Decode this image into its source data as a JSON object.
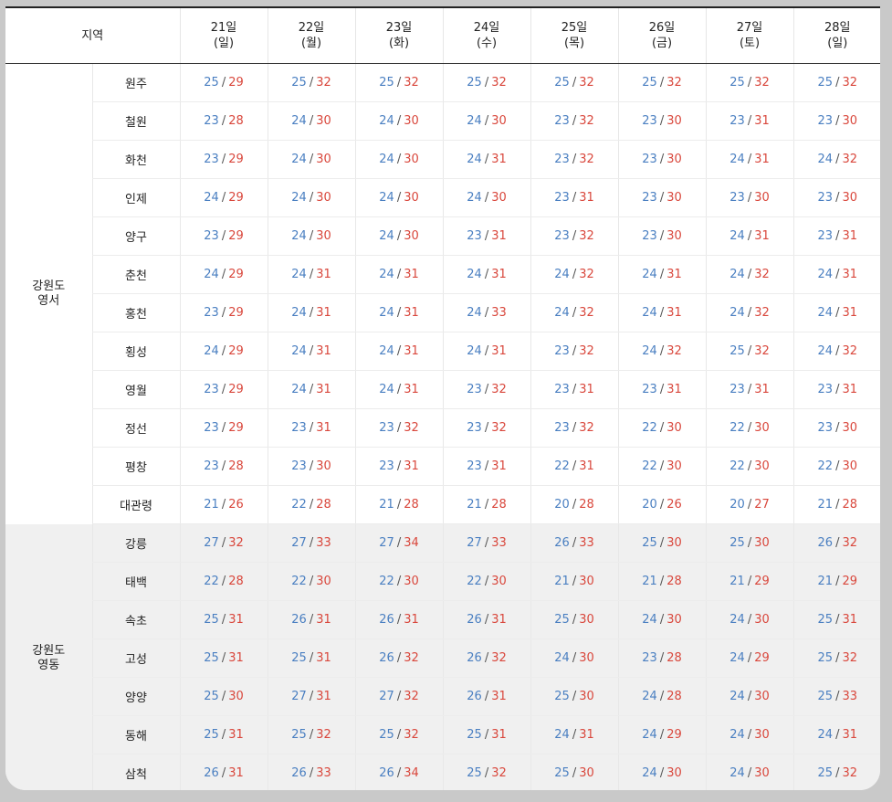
{
  "header": {
    "region_label": "지역",
    "days": [
      {
        "date": "21일",
        "weekday": "(일)"
      },
      {
        "date": "22일",
        "weekday": "(월)"
      },
      {
        "date": "23일",
        "weekday": "(화)"
      },
      {
        "date": "24일",
        "weekday": "(수)"
      },
      {
        "date": "25일",
        "weekday": "(목)"
      },
      {
        "date": "26일",
        "weekday": "(금)"
      },
      {
        "date": "27일",
        "weekday": "(토)"
      },
      {
        "date": "28일",
        "weekday": "(일)"
      }
    ]
  },
  "separator": "/",
  "colors": {
    "low_temp": "#4a7fc1",
    "high_temp": "#d9473c",
    "east_row_bg": "#f0f0f0"
  },
  "groups": [
    {
      "name_line1": "강원도",
      "name_line2": "영서",
      "shaded": false,
      "rows": [
        {
          "city": "원주",
          "temps": [
            [
              25,
              29
            ],
            [
              25,
              32
            ],
            [
              25,
              32
            ],
            [
              25,
              32
            ],
            [
              25,
              32
            ],
            [
              25,
              32
            ],
            [
              25,
              32
            ],
            [
              25,
              32
            ]
          ]
        },
        {
          "city": "철원",
          "temps": [
            [
              23,
              28
            ],
            [
              24,
              30
            ],
            [
              24,
              30
            ],
            [
              24,
              30
            ],
            [
              23,
              32
            ],
            [
              23,
              30
            ],
            [
              23,
              31
            ],
            [
              23,
              30
            ]
          ]
        },
        {
          "city": "화천",
          "temps": [
            [
              23,
              29
            ],
            [
              24,
              30
            ],
            [
              24,
              30
            ],
            [
              24,
              31
            ],
            [
              23,
              32
            ],
            [
              23,
              30
            ],
            [
              24,
              31
            ],
            [
              24,
              32
            ]
          ]
        },
        {
          "city": "인제",
          "temps": [
            [
              24,
              29
            ],
            [
              24,
              30
            ],
            [
              24,
              30
            ],
            [
              24,
              30
            ],
            [
              23,
              31
            ],
            [
              23,
              30
            ],
            [
              23,
              30
            ],
            [
              23,
              30
            ]
          ]
        },
        {
          "city": "양구",
          "temps": [
            [
              23,
              29
            ],
            [
              24,
              30
            ],
            [
              24,
              30
            ],
            [
              23,
              31
            ],
            [
              23,
              32
            ],
            [
              23,
              30
            ],
            [
              24,
              31
            ],
            [
              23,
              31
            ]
          ]
        },
        {
          "city": "춘천",
          "temps": [
            [
              24,
              29
            ],
            [
              24,
              31
            ],
            [
              24,
              31
            ],
            [
              24,
              31
            ],
            [
              24,
              32
            ],
            [
              24,
              31
            ],
            [
              24,
              32
            ],
            [
              24,
              31
            ]
          ]
        },
        {
          "city": "홍천",
          "temps": [
            [
              23,
              29
            ],
            [
              24,
              31
            ],
            [
              24,
              31
            ],
            [
              24,
              33
            ],
            [
              24,
              32
            ],
            [
              24,
              31
            ],
            [
              24,
              32
            ],
            [
              24,
              31
            ]
          ]
        },
        {
          "city": "횡성",
          "temps": [
            [
              24,
              29
            ],
            [
              24,
              31
            ],
            [
              24,
              31
            ],
            [
              24,
              31
            ],
            [
              23,
              32
            ],
            [
              24,
              32
            ],
            [
              25,
              32
            ],
            [
              24,
              32
            ]
          ]
        },
        {
          "city": "영월",
          "temps": [
            [
              23,
              29
            ],
            [
              24,
              31
            ],
            [
              24,
              31
            ],
            [
              23,
              32
            ],
            [
              23,
              31
            ],
            [
              23,
              31
            ],
            [
              23,
              31
            ],
            [
              23,
              31
            ]
          ]
        },
        {
          "city": "정선",
          "temps": [
            [
              23,
              29
            ],
            [
              23,
              31
            ],
            [
              23,
              32
            ],
            [
              23,
              32
            ],
            [
              23,
              32
            ],
            [
              22,
              30
            ],
            [
              22,
              30
            ],
            [
              23,
              30
            ]
          ]
        },
        {
          "city": "평창",
          "temps": [
            [
              23,
              28
            ],
            [
              23,
              30
            ],
            [
              23,
              31
            ],
            [
              23,
              31
            ],
            [
              22,
              31
            ],
            [
              22,
              30
            ],
            [
              22,
              30
            ],
            [
              22,
              30
            ]
          ]
        },
        {
          "city": "대관령",
          "temps": [
            [
              21,
              26
            ],
            [
              22,
              28
            ],
            [
              21,
              28
            ],
            [
              21,
              28
            ],
            [
              20,
              28
            ],
            [
              20,
              26
            ],
            [
              20,
              27
            ],
            [
              21,
              28
            ]
          ]
        }
      ]
    },
    {
      "name_line1": "강원도",
      "name_line2": "영동",
      "shaded": true,
      "rows": [
        {
          "city": "강릉",
          "temps": [
            [
              27,
              32
            ],
            [
              27,
              33
            ],
            [
              27,
              34
            ],
            [
              27,
              33
            ],
            [
              26,
              33
            ],
            [
              25,
              30
            ],
            [
              25,
              30
            ],
            [
              26,
              32
            ]
          ]
        },
        {
          "city": "태백",
          "temps": [
            [
              22,
              28
            ],
            [
              22,
              30
            ],
            [
              22,
              30
            ],
            [
              22,
              30
            ],
            [
              21,
              30
            ],
            [
              21,
              28
            ],
            [
              21,
              29
            ],
            [
              21,
              29
            ]
          ]
        },
        {
          "city": "속초",
          "temps": [
            [
              25,
              31
            ],
            [
              26,
              31
            ],
            [
              26,
              31
            ],
            [
              26,
              31
            ],
            [
              25,
              30
            ],
            [
              24,
              30
            ],
            [
              24,
              30
            ],
            [
              25,
              31
            ]
          ]
        },
        {
          "city": "고성",
          "temps": [
            [
              25,
              31
            ],
            [
              25,
              31
            ],
            [
              26,
              32
            ],
            [
              26,
              32
            ],
            [
              24,
              30
            ],
            [
              23,
              28
            ],
            [
              24,
              29
            ],
            [
              25,
              32
            ]
          ]
        },
        {
          "city": "양양",
          "temps": [
            [
              25,
              30
            ],
            [
              27,
              31
            ],
            [
              27,
              32
            ],
            [
              26,
              31
            ],
            [
              25,
              30
            ],
            [
              24,
              28
            ],
            [
              24,
              30
            ],
            [
              25,
              33
            ]
          ]
        },
        {
          "city": "동해",
          "temps": [
            [
              25,
              31
            ],
            [
              25,
              32
            ],
            [
              25,
              32
            ],
            [
              25,
              31
            ],
            [
              24,
              31
            ],
            [
              24,
              29
            ],
            [
              24,
              30
            ],
            [
              24,
              31
            ]
          ]
        },
        {
          "city": "삼척",
          "temps": [
            [
              26,
              31
            ],
            [
              26,
              33
            ],
            [
              26,
              34
            ],
            [
              25,
              32
            ],
            [
              25,
              30
            ],
            [
              24,
              30
            ],
            [
              24,
              30
            ],
            [
              25,
              32
            ]
          ]
        }
      ]
    }
  ]
}
